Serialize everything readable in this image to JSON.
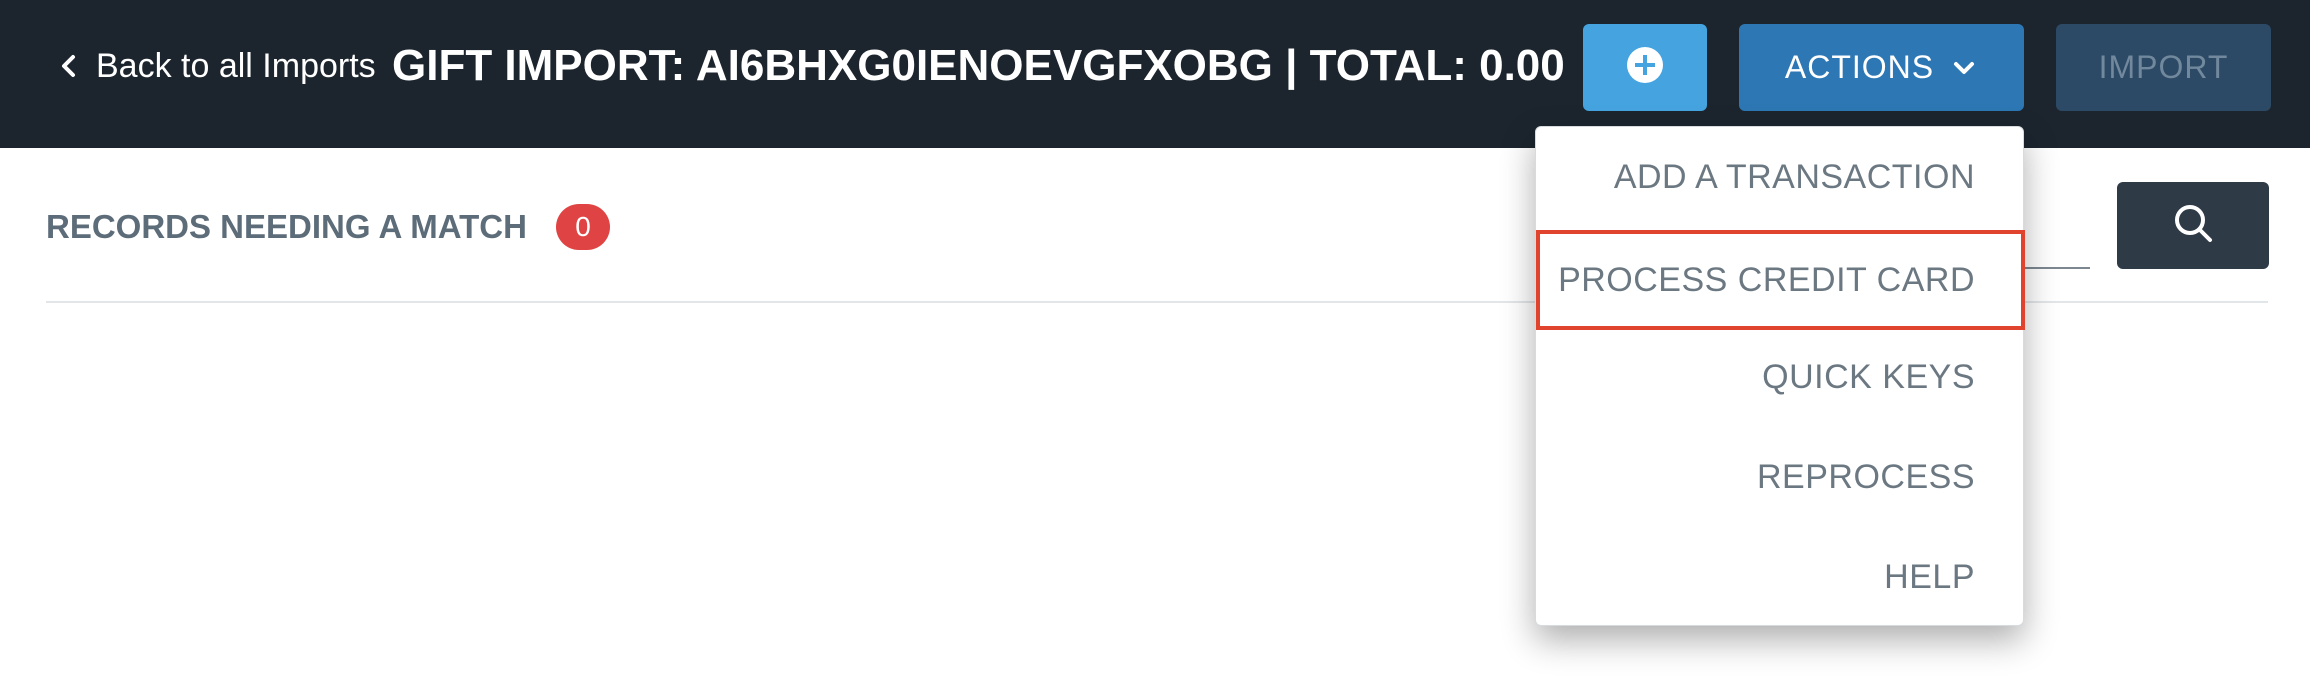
{
  "header": {
    "back_label": "Back to all Imports",
    "title": "GIFT IMPORT: AI6BHXG0IENOEVGFXOBG | TOTAL: 0.00",
    "actions_label": "ACTIONS",
    "import_label": "IMPORT"
  },
  "records": {
    "label": "RECORDS NEEDING A MATCH",
    "count": "0"
  },
  "actions_menu": {
    "items": [
      {
        "label": "ADD A TRANSACTION"
      },
      {
        "label": "PROCESS CREDIT CARD"
      },
      {
        "label": "QUICK KEYS"
      },
      {
        "label": "REPROCESS"
      },
      {
        "label": "HELP"
      }
    ]
  },
  "colors": {
    "header_bg": "#1c252e",
    "add_button": "#45a4e0",
    "actions_button": "#2d77b4",
    "import_button": "#2c4a66",
    "badge": "#e04343",
    "highlight_outline": "#e0432e",
    "search_button": "#2e3b46"
  },
  "icons": {
    "back": "chevron-left-icon",
    "add": "plus-circle-icon",
    "actions_caret": "chevron-down-icon",
    "search": "search-icon"
  }
}
